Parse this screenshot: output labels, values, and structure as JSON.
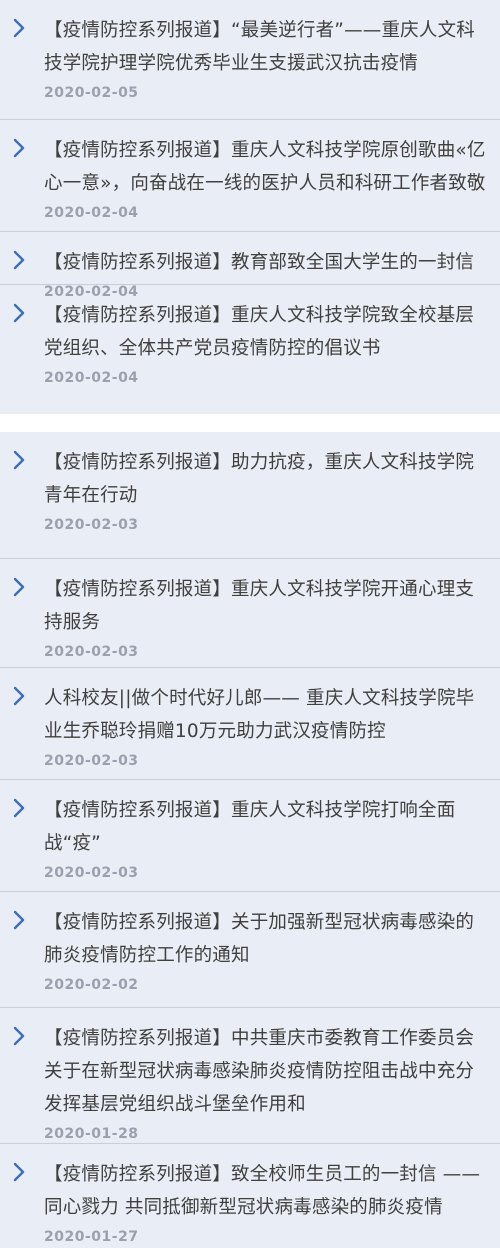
{
  "news_list": {
    "groups": [
      [
        {
          "title": "【疫情防控系列报道】“最美逆行者”——重庆人文科技学院护理学院优秀毕业生支援武汉抗击疫情",
          "date": "2020-02-05"
        },
        {
          "title": "【疫情防控系列报道】重庆人文科技学院原创歌曲«亿心一意»，向奋战在一线的医护人员和科研工作者致敬",
          "date": "2020-02-04"
        },
        {
          "title": "【疫情防控系列报道】教育部致全国大学生的一封信",
          "date": "2020-02-04"
        },
        {
          "title": "【疫情防控系列报道】重庆人文科技学院致全校基层党组织、全体共产党员疫情防控的倡议书",
          "date": "2020-02-04"
        }
      ],
      [
        {
          "title": "【疫情防控系列报道】助力抗疫，重庆人文科技学院青年在行动",
          "date": "2020-02-03"
        },
        {
          "title": "【疫情防控系列报道】重庆人文科技学院开通心理支持服务",
          "date": "2020-02-03"
        },
        {
          "title": "人科校友||做个时代好儿郎—— 重庆人文科技学院毕业生乔聪玲捐赠10万元助力武汉疫情防控",
          "date": "2020-02-03"
        },
        {
          "title": "【疫情防控系列报道】重庆人文科技学院打响全面战“疫”",
          "date": "2020-02-03"
        },
        {
          "title": "【疫情防控系列报道】关于加强新型冠状病毒感染的肺炎疫情防控工作的通知",
          "date": "2020-02-02"
        },
        {
          "title": "【疫情防控系列报道】中共重庆市委教育工作委员会关于在新型冠状病毒感染肺炎疫情防控阻击战中充分发挥基层党组织战斗堡垒作用和",
          "date": "2020-01-28"
        },
        {
          "title": "【疫情防控系列报道】致全校师生员工的一封信 ——同心戮力 共同抵御新型冠状病毒感染的肺炎疫情",
          "date": "2020-01-27"
        }
      ]
    ]
  },
  "icons": {
    "item_icon": "chevron-right-icon"
  },
  "colors": {
    "chevron": "#3a6fb5",
    "title": "#404040",
    "date": "#9aa0ad",
    "background": "#e9edf5"
  }
}
